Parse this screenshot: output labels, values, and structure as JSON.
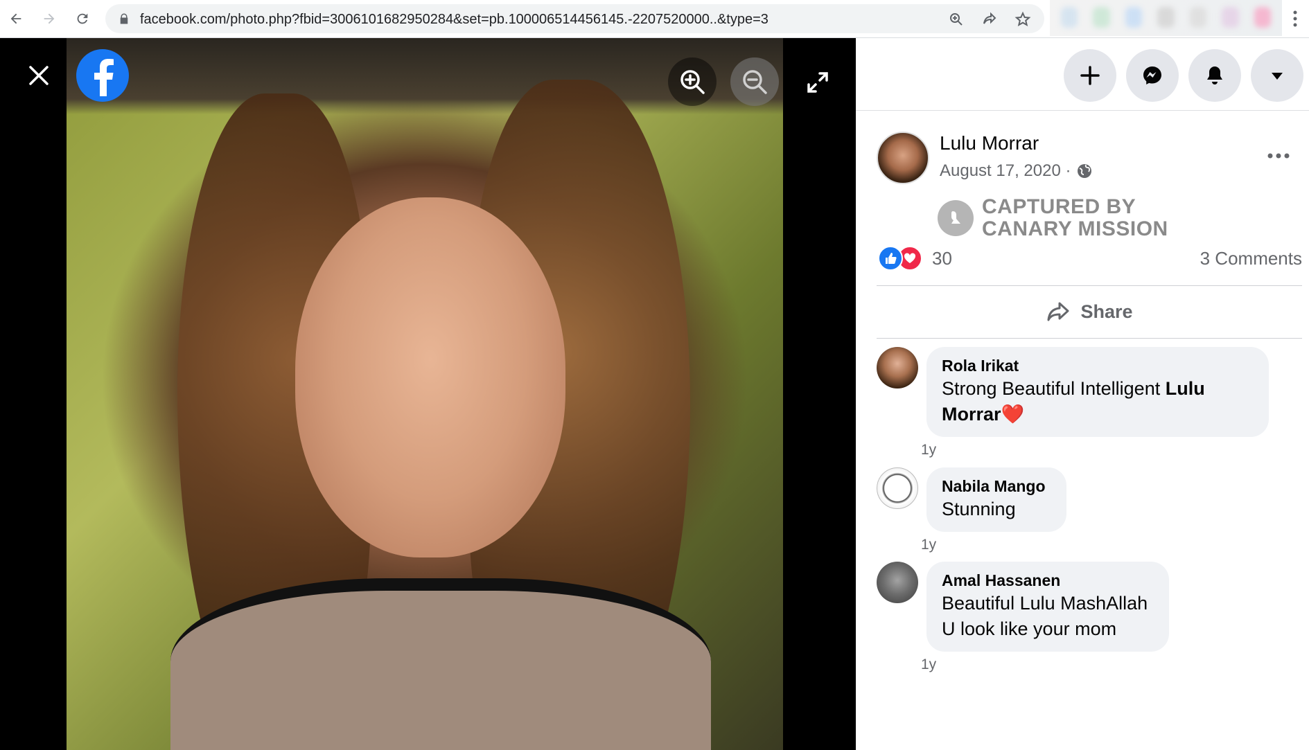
{
  "browser": {
    "url": "facebook.com/photo.php?fbid=3006101682950284&set=pb.100006514456145.-2207520000..&type=3"
  },
  "post": {
    "author": "Lulu Morrar",
    "date": "August 17, 2020 ·",
    "watermark_line1": "CAPTURED BY",
    "watermark_line2": "CANARY MISSION",
    "reaction_count": "30",
    "comments_label": "3 Comments",
    "share_label": "Share"
  },
  "comments": [
    {
      "name": "Rola Irikat",
      "text_start": "Strong Beautiful Intelligent ",
      "text_bold": "Lulu Morrar",
      "text_end": "❤️",
      "time": "1y"
    },
    {
      "name": "Nabila Mango",
      "text": "Stunning",
      "time": "1y"
    },
    {
      "name": "Amal Hassanen",
      "text_line1": "Beautiful Lulu MashAllah",
      "text_line2": "U look like your mom",
      "time": "1y"
    }
  ],
  "colors": {
    "brand": "#1877f2",
    "love": "#f02849",
    "muted_text": "#65676b",
    "bubble_bg": "#f0f2f5"
  },
  "icons": {
    "close": "close-icon",
    "logo": "facebook-logo",
    "zoom_in": "zoom-in-icon",
    "zoom_out": "zoom-out-icon",
    "fullscreen": "expand-icon",
    "create": "plus-icon",
    "messenger": "messenger-icon",
    "notifications": "bell-icon",
    "account": "caret-down-icon"
  }
}
